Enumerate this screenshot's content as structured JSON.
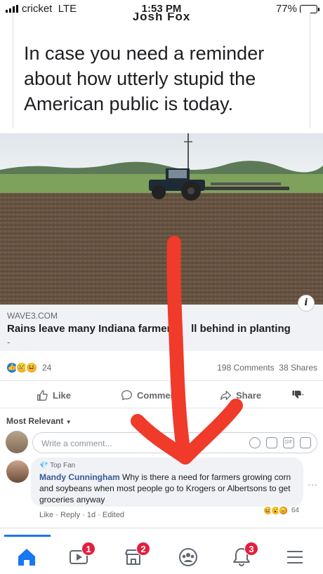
{
  "status_bar": {
    "carrier": "cricket",
    "network": "LTE",
    "time": "1:53 PM",
    "battery": "77%",
    "battery_level": 0.77
  },
  "meme": {
    "author_cut": "Josh Fox",
    "caption": "In case you need a reminder about how utterly stupid the American public is today."
  },
  "post": {
    "domain": "WAVE3.COM",
    "headline_part1": "Rains leave many Indiana farmers",
    "headline_part2": "ll behind in planting",
    "dash": "-",
    "reaction_count": "24",
    "comments": "198 Comments",
    "shares": "38 Shares"
  },
  "actions": {
    "like": "Like",
    "comment": "Comment",
    "share": "Share"
  },
  "comments_section": {
    "sort": "Most Relevant",
    "placeholder": "Write a comment...",
    "comment": {
      "badge": "Top Fan",
      "author": "Mandy Cunningham",
      "text": "Why is there a need for farmers growing corn and soybeans when most people go to Krogers or Albertsons to get groceries anyway",
      "meta": "Like · Reply · 1d · Edited",
      "reaction_count": "64"
    }
  },
  "nav": {
    "video_badge": "1",
    "marketplace_badge": "2",
    "notifications_badge": "3"
  },
  "colors": {
    "facebook_blue": "#1877f2",
    "badge_red": "#e41e3f",
    "arrow_red": "#f03a2a"
  }
}
